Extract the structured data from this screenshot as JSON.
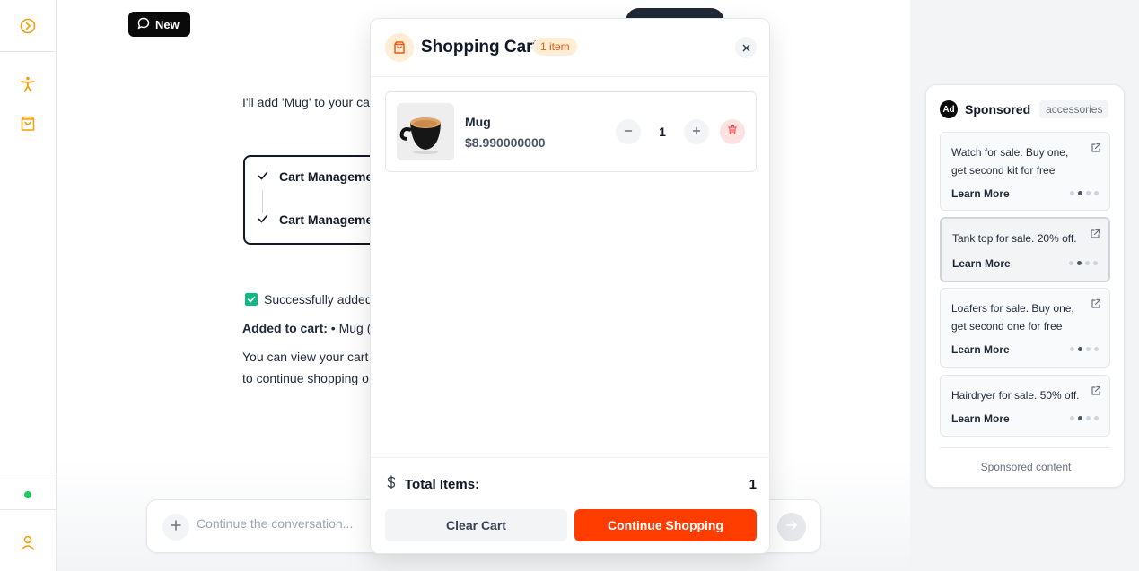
{
  "sidebar": {
    "toggle_icon": "chevron-right-circle-icon",
    "accessibility_icon": "accessibility-icon",
    "cart_icon": "shopping-bag-icon",
    "user_icon": "user-icon",
    "status_color": "#22c55e"
  },
  "header": {
    "new_label": "New"
  },
  "chat": {
    "intro": "I'll add 'Mug' to your ca",
    "tasks": [
      {
        "label": "Cart Manageme"
      },
      {
        "label": "Cart Manageme"
      }
    ],
    "success_text": "Successfully added",
    "added_label": "Added to cart:",
    "added_item": "• Mug (",
    "view_line1": "You can view your cart",
    "view_line2": "to continue shopping o"
  },
  "composer": {
    "placeholder": "Continue the conversation..."
  },
  "cart": {
    "title": "Shopping Cart",
    "count_badge": "1 item",
    "items": [
      {
        "name": "Mug",
        "price": "$8.990000000",
        "quantity": "1"
      }
    ],
    "total_label": "Total Items:",
    "total_value": "1",
    "clear_label": "Clear Cart",
    "continue_label": "Continue Shopping",
    "accent_color": "#ff3d00"
  },
  "ads": {
    "badge": "Ad",
    "title": "Sponsored",
    "tag": "accessories",
    "cards": [
      {
        "text": "Watch for sale. Buy one, get second kit for free",
        "cta": "Learn More"
      },
      {
        "text": "Tank top for sale. 20% off.",
        "cta": "Learn More"
      },
      {
        "text": "Loafers for sale. Buy one, get second one for free",
        "cta": "Learn More"
      },
      {
        "text": "Hairdryer for sale. 50% off.",
        "cta": "Learn More"
      }
    ],
    "footer": "Sponsored content"
  }
}
